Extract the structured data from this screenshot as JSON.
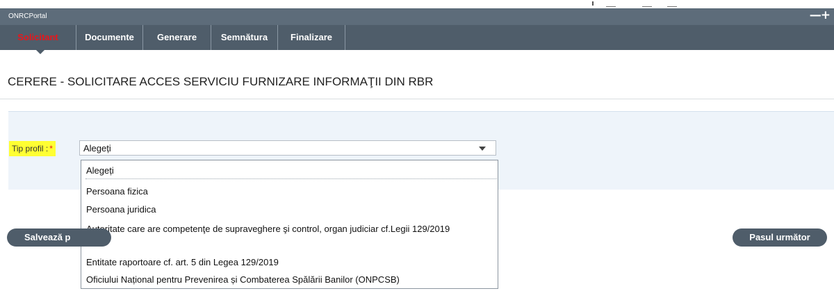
{
  "portal": {
    "title": "ONRCPortal",
    "controls": "—+"
  },
  "tabs": [
    {
      "label": "Solicitant",
      "active": true
    },
    {
      "label": "Documente",
      "active": false
    },
    {
      "label": "Generare",
      "active": false
    },
    {
      "label": "Semnătura",
      "active": false
    },
    {
      "label": "Finalizare",
      "active": false
    }
  ],
  "page": {
    "title": "CERERE - SOLICITARE ACCES SERVICIU FURNIZARE INFORMAŢII DIN RBR"
  },
  "form": {
    "profile_label": "Tip profil :",
    "required_mark": "*",
    "selected_value": "Alegeți",
    "options": [
      "Alegeți",
      "Persoana fizica",
      "Persoana juridica",
      "Autoritate care are competenţe de supraveghere şi control, organ judiciar cf.Legii 129/2019",
      "Entitate raportoare cf. art. 5 din Legea 129/2019",
      "Oficiului Național pentru Prevenirea și Combaterea Spălării Banilor (ONPCSB)"
    ]
  },
  "buttons": {
    "save_label": "Salvează p",
    "next_label": "Pasul următor"
  },
  "colors": {
    "tab_bar": "#4f5d6a",
    "active_tab_text": "#e8161b",
    "label_highlight": "#ffff33",
    "panel_bg": "#eef4fa"
  }
}
